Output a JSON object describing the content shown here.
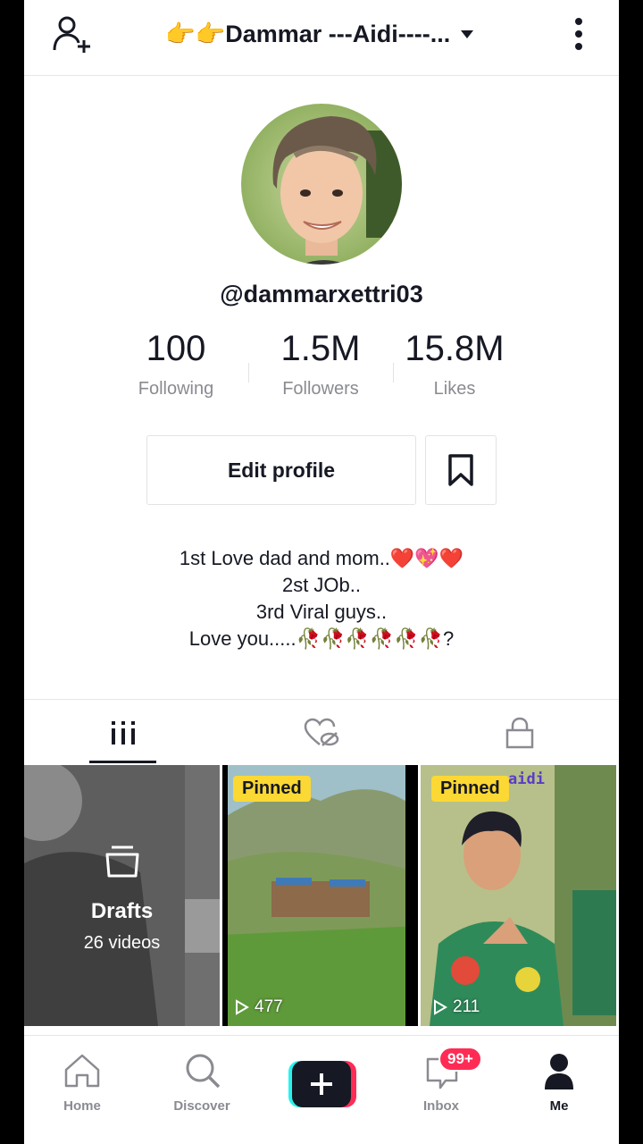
{
  "header": {
    "title": "👉👉Dammar ---Aidi----...",
    "add_user_icon": "add-user-icon",
    "more_icon": "more-vertical-icon"
  },
  "profile": {
    "username": "@dammarxettri03",
    "stats": [
      {
        "value": "100",
        "label": "Following"
      },
      {
        "value": "1.5M",
        "label": "Followers"
      },
      {
        "value": "15.8M",
        "label": "Likes"
      }
    ],
    "edit_label": "Edit profile",
    "bio": [
      "1st Love dad and mom..❤️💖❤️",
      "2st JOb..",
      "3rd Viral guys..",
      "Love you.....🥀🥀🥀🥀🥀🥀?"
    ]
  },
  "tabs": [
    "videos-grid-icon",
    "liked-hidden-icon",
    "lock-icon"
  ],
  "videos": {
    "drafts": {
      "label": "Drafts",
      "count": "26 videos"
    },
    "items": [
      {
        "pinned": "Pinned",
        "views": "477"
      },
      {
        "pinned": "Pinned",
        "views": "211",
        "overlay_text": "aidi"
      }
    ]
  },
  "bottom_nav": {
    "home": "Home",
    "discover": "Discover",
    "inbox": "Inbox",
    "inbox_badge": "99+",
    "me": "Me"
  },
  "colors": {
    "accent": "#fe2c55",
    "pinned": "#fbd833",
    "text": "#161823",
    "muted": "#8a8b91"
  }
}
